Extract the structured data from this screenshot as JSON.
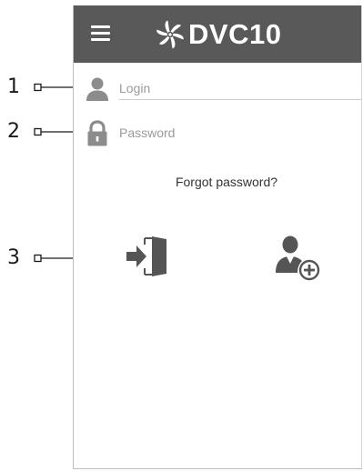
{
  "app": {
    "title": "DVC10",
    "logo_icon": "fan-icon",
    "menu_icon": "hamburger-menu-icon",
    "header_color": "#595959"
  },
  "login_form": {
    "login": {
      "placeholder": "Login",
      "value": "",
      "icon": "user-icon"
    },
    "password": {
      "placeholder": "Password",
      "value": "",
      "icon": "lock-icon"
    },
    "forgot_password_label": "Forgot password?"
  },
  "actions": {
    "sign_in_icon": "sign-in-icon",
    "add_user_icon": "add-user-icon"
  },
  "callouts": [
    {
      "number": "1",
      "target": "login-field"
    },
    {
      "number": "2",
      "target": "password-field"
    },
    {
      "number": "3",
      "target": "sign-in-button"
    }
  ]
}
